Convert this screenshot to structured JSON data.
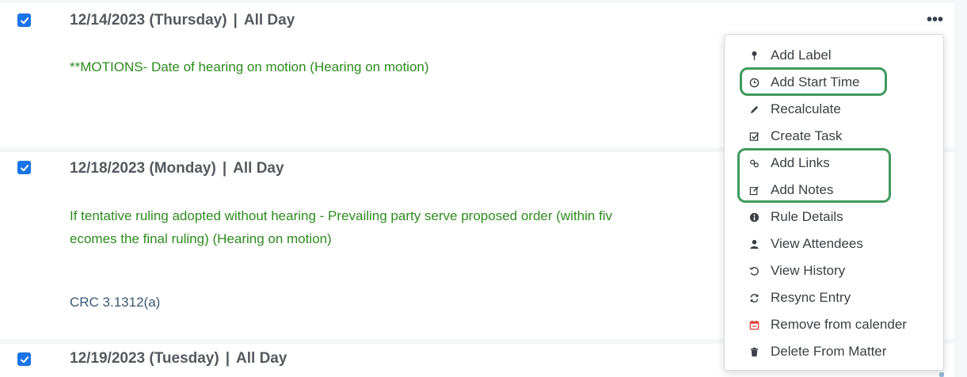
{
  "entries": [
    {
      "date": "12/14/2023 (Thursday)",
      "separator": "|",
      "time": "All Day",
      "text_lines": [
        "**MOTIONS- Date of hearing on motion (Hearing on motion)"
      ],
      "rule_ref": ""
    },
    {
      "date": "12/18/2023 (Monday)",
      "separator": "|",
      "time": "All Day",
      "text_lines": [
        "If tentative ruling adopted without hearing - Prevailing party serve proposed order (within fiv",
        "ecomes the final ruling) (Hearing on motion)"
      ],
      "rule_ref": "CRC 3.1312(a)"
    },
    {
      "date": "12/19/2023 (Tuesday)",
      "separator": "|",
      "time": "All Day",
      "text_lines": [],
      "rule_ref": ""
    }
  ],
  "more_button": "•••",
  "menu": {
    "items": [
      {
        "label": "Add Label",
        "icon": "pin-icon"
      },
      {
        "label": "Add Start Time",
        "icon": "clock-icon"
      },
      {
        "label": "Recalculate",
        "icon": "pencil-icon"
      },
      {
        "label": "Create Task",
        "icon": "check-square-icon"
      },
      {
        "label": "Add Links",
        "icon": "link-icon"
      },
      {
        "label": "Add Notes",
        "icon": "edit-icon"
      },
      {
        "label": "Rule Details",
        "icon": "info-icon"
      },
      {
        "label": "View Attendees",
        "icon": "user-icon"
      },
      {
        "label": "View History",
        "icon": "history-icon"
      },
      {
        "label": "Resync Entry",
        "icon": "refresh-icon"
      },
      {
        "label": "Remove from calender",
        "icon": "calendar-remove-icon"
      },
      {
        "label": "Delete From Matter",
        "icon": "trash-icon"
      }
    ]
  },
  "colors": {
    "checkbox": "#1a73e8",
    "event_text": "#2e8b1f",
    "highlight": "#3f9a5e",
    "remove_icon": "#e53935"
  }
}
